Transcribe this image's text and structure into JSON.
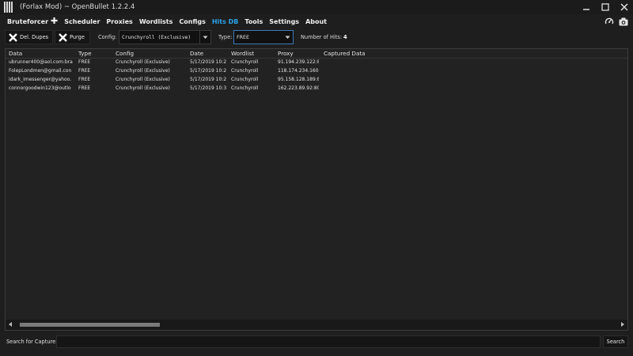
{
  "window": {
    "title": "(Forlax Mod) ~ OpenBullet 1.2.2.4"
  },
  "menu": {
    "items": [
      {
        "label": "Bruteforcer",
        "plus": "✚"
      },
      {
        "label": "Scheduler"
      },
      {
        "label": "Proxies"
      },
      {
        "label": "Wordlists"
      },
      {
        "label": "Configs"
      },
      {
        "label": "Hits DB",
        "active": true
      },
      {
        "label": "Tools"
      },
      {
        "label": "Settings"
      },
      {
        "label": "About"
      }
    ]
  },
  "toolbar": {
    "del_dupes_label": "Del. Dupes",
    "purge_label": "Purge",
    "config_label": "Config:",
    "config_value": "Crunchyroll (Exclusive)",
    "type_label": "Type:",
    "type_value": "FREE",
    "hits_label": "Number of Hits:",
    "hits_count": "4"
  },
  "grid": {
    "columns": [
      "Data",
      "Type",
      "Config",
      "Date",
      "Wordlist",
      "Proxy",
      "Captured Data"
    ],
    "rows": [
      [
        "ubrunner400@aol.com:bra",
        "FREE",
        "Crunchyroll (Exclusive)",
        "5/17/2019 10:2",
        "Crunchyroll",
        "91.194.239.122:8",
        ""
      ],
      [
        "FolepLondmen@gmail.con",
        "FREE",
        "Crunchyroll (Exclusive)",
        "5/17/2019 10:2",
        "Crunchyroll",
        "118.174.234.160:",
        ""
      ],
      [
        "idark_imessenger@yahoo.",
        "FREE",
        "Crunchyroll (Exclusive)",
        "5/17/2019 10:2",
        "Crunchyroll",
        "95.158.128.189:8",
        ""
      ],
      [
        "connorgoodwin123@outlo",
        "FREE",
        "Crunchyroll (Exclusive)",
        "5/17/2019 10:3",
        "Crunchyroll",
        "162.223.89.92:80",
        ""
      ]
    ]
  },
  "search": {
    "label": "Search for Capture:",
    "value": "",
    "button_label": "Search"
  },
  "colors": {
    "accent": "#2aa3e8",
    "background": "#1e1e1e"
  }
}
